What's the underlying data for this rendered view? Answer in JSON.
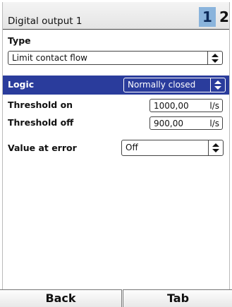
{
  "header": {
    "title": "Digital output 1",
    "tabs": [
      "1",
      "2"
    ]
  },
  "fields": {
    "type": {
      "label": "Type",
      "value": "Limit contact flow"
    },
    "logic": {
      "label": "Logic",
      "value": "Normally closed"
    },
    "threshold_on": {
      "label": "Threshold on",
      "value": "1000,00",
      "unit": "l/s"
    },
    "threshold_off": {
      "label": "Threshold off",
      "value": "900,00",
      "unit": "l/s"
    },
    "value_at_error": {
      "label": "Value at error",
      "value": "Off"
    }
  },
  "softkeys": {
    "left": "Back",
    "right": "Tab"
  },
  "colors": {
    "selection": "#2a3c9c",
    "active_tab": "#8ab4dc"
  },
  "icons": {
    "spinner": "up-down-arrows-icon"
  }
}
